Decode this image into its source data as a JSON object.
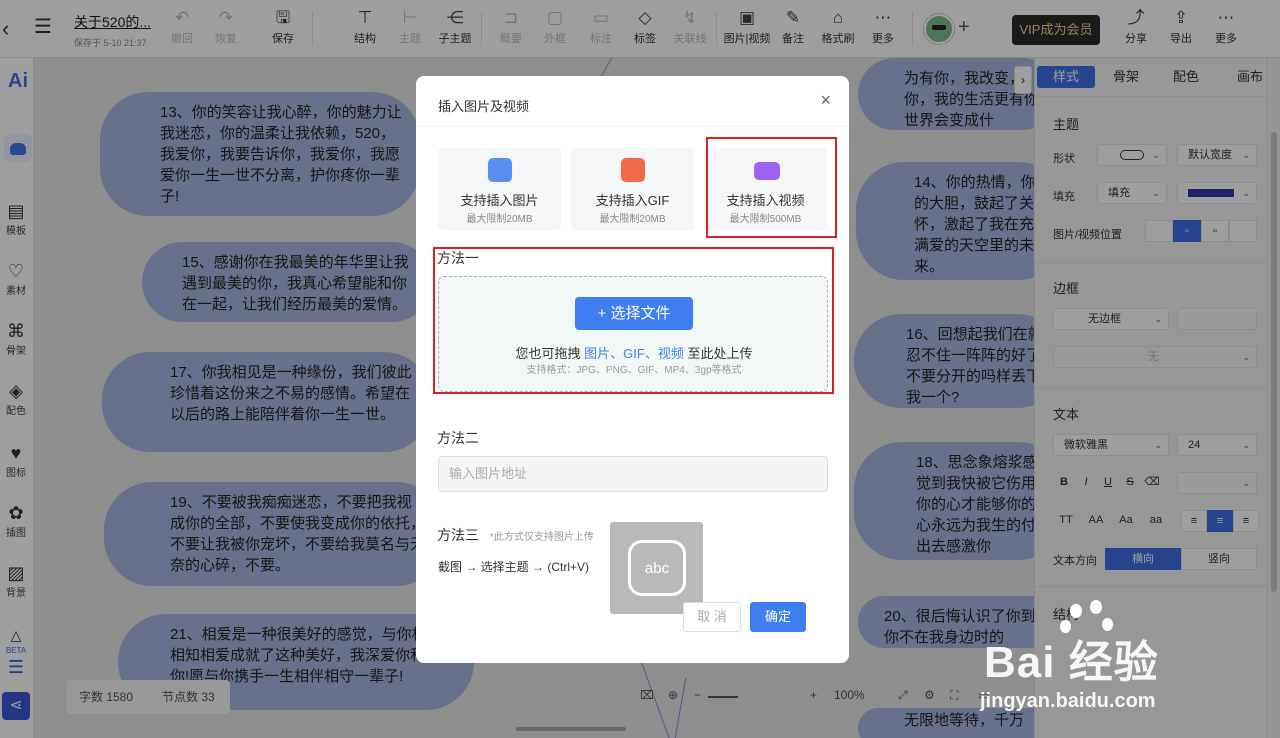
{
  "toolbar": {
    "doc_title": "关于520的...",
    "saved_text": "保存于 5-10 21:37",
    "items": [
      {
        "label": "撤回",
        "icon": "undo-icon",
        "disabled": true
      },
      {
        "label": "恢复",
        "icon": "redo-icon",
        "disabled": true
      },
      {
        "label": "保存",
        "icon": "save-icon",
        "disabled": false
      },
      {
        "label": "结构",
        "icon": "structure-icon",
        "disabled": false
      },
      {
        "label": "主题",
        "icon": "topic-icon",
        "disabled": true
      },
      {
        "label": "子主题",
        "icon": "subtopic-icon",
        "disabled": false
      },
      {
        "label": "概要",
        "icon": "summary-icon",
        "disabled": true
      },
      {
        "label": "外框",
        "icon": "frame-icon",
        "disabled": true
      },
      {
        "label": "标注",
        "icon": "callout-icon",
        "disabled": true
      },
      {
        "label": "标签",
        "icon": "tag-icon",
        "disabled": false
      },
      {
        "label": "关联线",
        "icon": "relation-line-icon",
        "disabled": true
      },
      {
        "label": "图片|视频",
        "icon": "image-video-icon",
        "disabled": false
      },
      {
        "label": "备注",
        "icon": "note-icon",
        "disabled": false
      },
      {
        "label": "格式刷",
        "icon": "format-brush-icon",
        "disabled": false
      },
      {
        "label": "更多",
        "icon": "more-icon",
        "disabled": false
      }
    ],
    "vip_label": "VIP成为会员",
    "right_items": [
      {
        "label": "分享",
        "icon": "share-icon"
      },
      {
        "label": "导出",
        "icon": "export-icon"
      },
      {
        "label": "更多",
        "icon": "more-icon"
      }
    ]
  },
  "leftbar": {
    "logo": "Ai",
    "items": [
      {
        "label": "模板",
        "icon": "template-icon"
      },
      {
        "label": "素材",
        "icon": "material-icon"
      },
      {
        "label": "骨架",
        "icon": "skeleton-icon"
      },
      {
        "label": "配色",
        "icon": "color-icon"
      },
      {
        "label": "图标",
        "icon": "icon-library-icon"
      },
      {
        "label": "插图",
        "icon": "illustration-icon"
      },
      {
        "label": "背景",
        "icon": "background-icon"
      },
      {
        "label": "BETA",
        "icon": "beta-icon"
      }
    ]
  },
  "canvas": {
    "nodes_left": [
      "13、你的笑容让我心醉，你的魅力让我迷恋，你的温柔让我依赖，520，我爱你，我要告诉你，我爱你，我愿爱你一生一世不分离，护你疼你一辈子!",
      "15、感谢你在我最美的年华里让我遇到最美的你，我真心希望能和你在一起，让我们经历最美的爱情。",
      "17、你我相见是一种缘份，我们彼此珍惜着这份来之不易的感情。希望在以后的路上能陪伴着你一生一世。",
      "19、不要被我痴痴迷恋，不要把我视成你的全部，不要使我变成你的依托，不要让我被你宠坏，不要给我莫名与无奈的心碎，不要。",
      "21、相爱是一种很美好的感觉，与你相识相知相爱成就了这种美好，我深爱你和感谢你!愿与你携手一生相伴相守一辈子!"
    ],
    "nodes_right": [
      "为有你，我改变，你，我的生活更有你世界会变成什",
      "14、你的热情，你的大胆，鼓起了关怀，激起了我在充满爱的天空里的未来。",
      "16、回想起我们在就忍不住一阵阵的好了不要分开的吗样丢下我一个?",
      "18、思念象熔浆感觉到我快被它伤用你的心才能够你的心永远为我生的付出去感激你",
      "20、很后悔认识了你到你不在我身边时的",
      "无限地等待，千万"
    ],
    "word_count_label": "字数 1580",
    "node_count_label": "节点数 33",
    "zoom_label": "100%"
  },
  "right_panel": {
    "tabs": [
      "样式",
      "骨架",
      "配色",
      "画布"
    ],
    "theme_section": "主题",
    "shape_label": "形状",
    "width_value": "默认宽度",
    "fill_label": "填充",
    "fill_value": "填充",
    "fill_color": "#3236a8",
    "image_pos_label": "图片/视频位置",
    "border_section": "边框",
    "border_value": "无边框",
    "border_none": "无",
    "text_section": "文本",
    "font_value": "微软雅黑",
    "size_value": "24",
    "case_buttons": [
      "TT",
      "AA",
      "Aa",
      "aa"
    ],
    "text_dir_label": "文本方向",
    "dir_horizontal": "横向",
    "dir_vertical": "竖向",
    "structure_section": "结构"
  },
  "modal": {
    "title": "插入图片及视频",
    "cards": [
      {
        "title": "支持插入图片",
        "sub": "最大限制20MB",
        "icon": "image-icon",
        "color": "#5a8df0"
      },
      {
        "title": "支持插入GIF",
        "sub": "最大限制20MB",
        "icon": "gif-icon",
        "color": "#f06a4a"
      },
      {
        "title": "支持插入视频",
        "sub": "最大限制500MB",
        "icon": "video-icon",
        "color": "#9b63f0"
      }
    ],
    "method1_label": "方法一",
    "choose_file_label": "+ 选择文件",
    "drag_prefix": "您也可拖拽",
    "drag_types": "图片、GIF、视频",
    "drag_suffix": "至此处上传",
    "formats_text": "支持格式：JPG、PNG、GIF、MP4、3gp等格式",
    "method2_label": "方法二",
    "url_placeholder": "输入图片地址",
    "method3_label": "方法三",
    "method3_note": "*此方式仅支持图片上传",
    "method3_steps": "截图 → 选择主题 → (Ctrl+V)",
    "abc_text": "abc",
    "cancel_label": "取 消",
    "ok_label": "确定"
  },
  "watermark": {
    "brand": "Bai 经验",
    "url": "jingyan.baidu.com"
  }
}
